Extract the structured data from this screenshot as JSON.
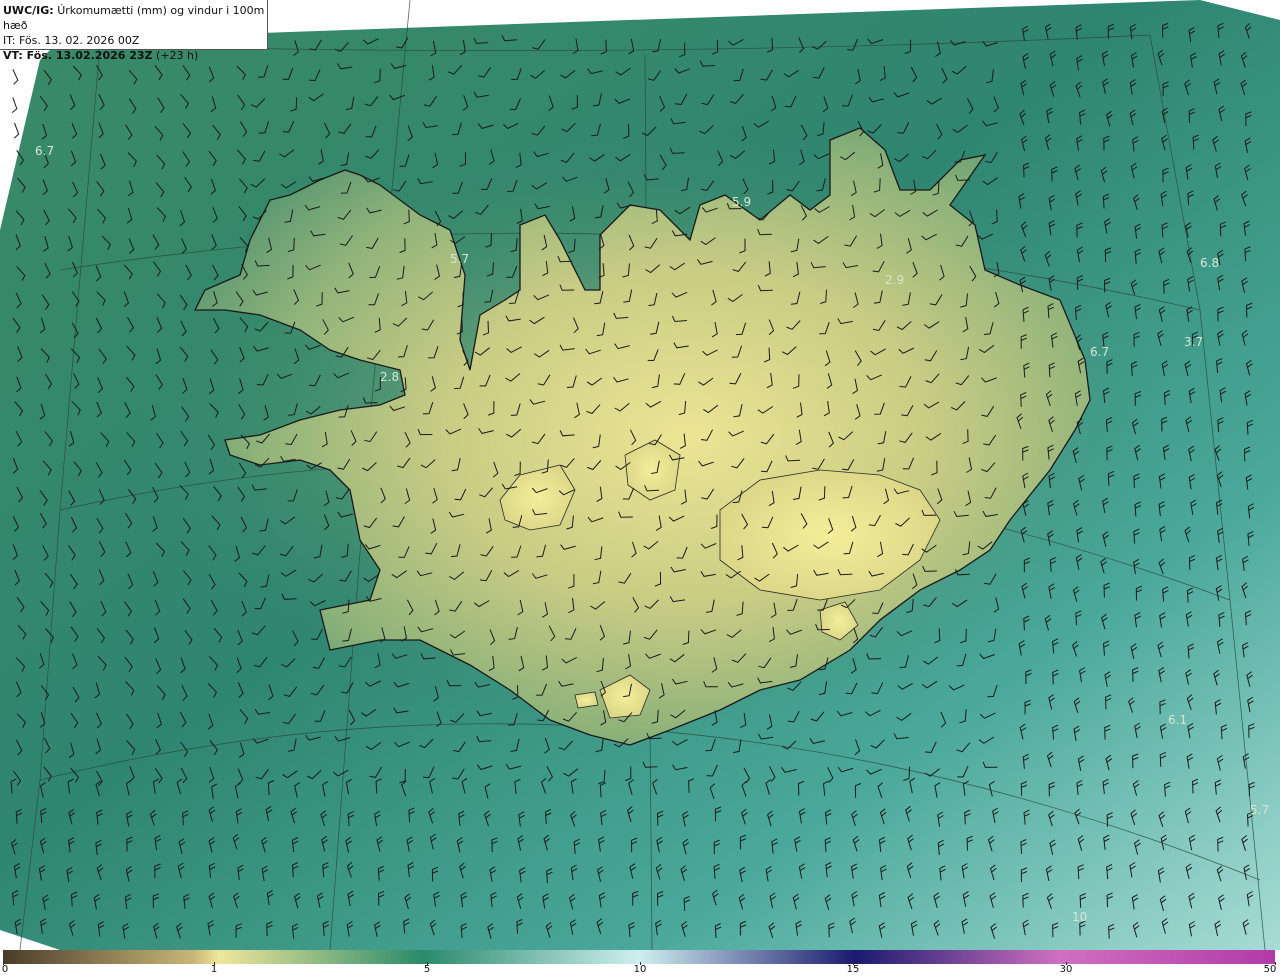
{
  "info": {
    "model": "UWC/IG:",
    "description": "Úrkomumætti (mm) og vindur i 100m hæð",
    "it": "IT: Fös. 13. 02. 2026 00Z",
    "vt_bold": "VT: Fös. 13.02.2026 23Z",
    "vt_lead": "(+23 h)"
  },
  "map_labels": [
    {
      "text": "6.7"
    },
    {
      "text": "5.9"
    },
    {
      "text": "5.7"
    },
    {
      "text": "2.9"
    },
    {
      "text": "6.8"
    },
    {
      "text": "6.7"
    },
    {
      "text": "3.7"
    },
    {
      "text": "2.8"
    },
    {
      "text": "6.1"
    },
    {
      "text": "5.7"
    },
    {
      "text": "10"
    }
  ],
  "colorbar": {
    "ticks": [
      "0",
      "1",
      "5",
      "10",
      "15",
      "30",
      "50"
    ],
    "colors": [
      "#4a3b2a",
      "#c9b677",
      "#efe79a",
      "#2a8a6a",
      "#cfeff0",
      "#1a1a6e",
      "#d070c0",
      "#b23aa8"
    ]
  },
  "colors": {
    "ocean": "#2f8a70",
    "land_low": "#6aa078",
    "land_high": "#e8e28e",
    "coast": "#1a1a1a"
  }
}
